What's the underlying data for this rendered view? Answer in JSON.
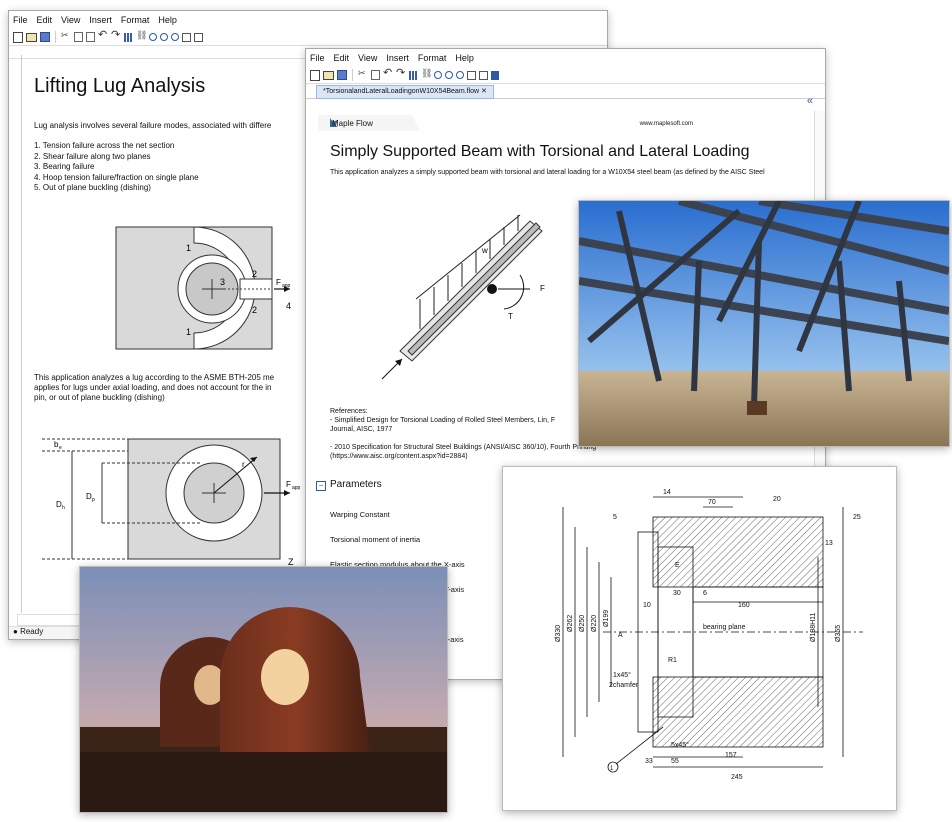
{
  "window1": {
    "menu": [
      "File",
      "Edit",
      "View",
      "Insert",
      "Format",
      "Help"
    ],
    "title": "Lifting Lug Analysis",
    "intro": "Lug analysis involves several failure modes, associated with differe",
    "failure_modes": [
      "1. Tension failure across the net section",
      "2. Shear failure along two planes",
      "3. Bearing failure",
      "4. Hoop tension failure/fraction on single plane",
      "5. Out of plane buckling (dishing)"
    ],
    "para2_l1": "This application analyzes a lug according to the ASME BTH-205 me",
    "para2_l2": "applies for lugs under axial loading, and does not account for the in",
    "para2_l3": "pin, or out of plane buckling (dishing)",
    "status": "Ready",
    "diagram1_labels": {
      "n1": "1",
      "n2": "2",
      "n3": "3",
      "n4": "4",
      "fapp": "F",
      "fapp_sub": "app"
    },
    "diagram2_labels": {
      "be": "b",
      "be_sub": "e",
      "dh": "D",
      "dh_sub": "h",
      "dp": "D",
      "dp_sub": "p",
      "r": "r",
      "fapp": "F",
      "fapp_sub": "app",
      "z": "Z"
    }
  },
  "window2": {
    "menu": [
      "File",
      "Edit",
      "View",
      "Insert",
      "Format",
      "Help"
    ],
    "tab": "*TorsionalandLateralLoadingonW10X54Beam.flow",
    "brand": "Maple Flow",
    "url": "www.maplesoft.com",
    "title": "Simply Supported Beam with Torsional and Lateral Loading",
    "intro": "This application analyzes a simply supported beam with torsional and lateral loading for a W10X54 steel beam (as defined by the AISC Steel",
    "refs": [
      "References:",
      "- Simplified Design for Torsional Loading of Rolled Steel Members, Lin, F",
      "Journal, AISC, 1977",
      "",
      "- 2010 Specification for Structural Steel Buildings (ANSI/AISC 360/10), Fourth Printing",
      "(https://www.aisc.org/content.aspx?id=2884)"
    ],
    "section": "Parameters",
    "params": [
      "Warping Constant",
      "Torsional moment of inertia",
      "Elastic section modulus about the X-axis",
      "Y-axis",
      "",
      "x-axis"
    ],
    "beam_labels": {
      "w": "w",
      "f": "F",
      "t": "T"
    }
  },
  "drawing": {
    "dims": {
      "d14": "14",
      "d70": "70",
      "d20": "20",
      "d5": "5",
      "d13": "13",
      "d25": "25",
      "d30": "30",
      "d6": "6",
      "d160": "160",
      "d10": "10",
      "dA": "A",
      "dE": "E",
      "d330": "Ø330",
      "d262": "Ø262",
      "d250": "Ø250",
      "d220": "Ø220",
      "d199": "Ø199",
      "dR1": "R1",
      "d1x45": "1x45°",
      "chamfer": "2chamfer",
      "d5x45": "5x45°",
      "d33": "33",
      "d55": "55",
      "d157": "157",
      "d245": "245",
      "bp": "bearing plane",
      "d198": "Ø198H11",
      "d355": "Ø355"
    },
    "balloon": "1"
  }
}
